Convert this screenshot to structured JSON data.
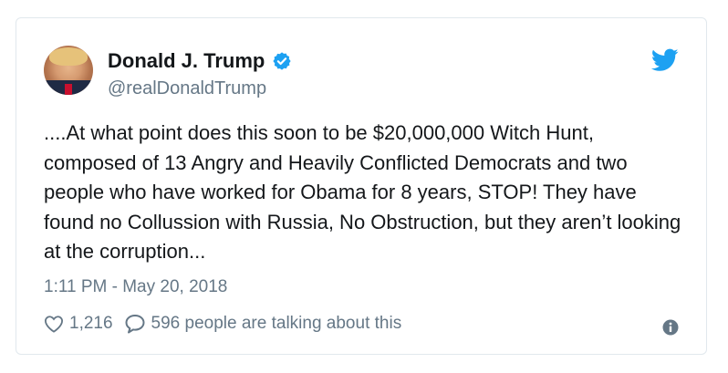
{
  "author": {
    "display_name": "Donald J. Trump",
    "handle": "@realDonaldTrump",
    "verified": true
  },
  "tweet": {
    "text": "....At what point does this soon to be $20,000,000 Witch Hunt, composed of 13 Angry and Heavily Conflicted Democrats and two people who have worked for Obama for 8 years, STOP! They have found no Collussion with Russia, No Obstruction, but they aren’t looking at the corruption...",
    "timestamp": "1:11 PM - May 20, 2018"
  },
  "engagement": {
    "likes": "1,216",
    "talking": "596 people are talking about this"
  },
  "icons": {
    "brand": "twitter-bird-icon",
    "verified": "verified-badge-icon",
    "like": "heart-icon",
    "reply": "speech-bubble-icon",
    "info": "info-icon"
  },
  "colors": {
    "brand_blue": "#1da1f2",
    "secondary_text": "#657786",
    "border": "#e1e8ed"
  }
}
